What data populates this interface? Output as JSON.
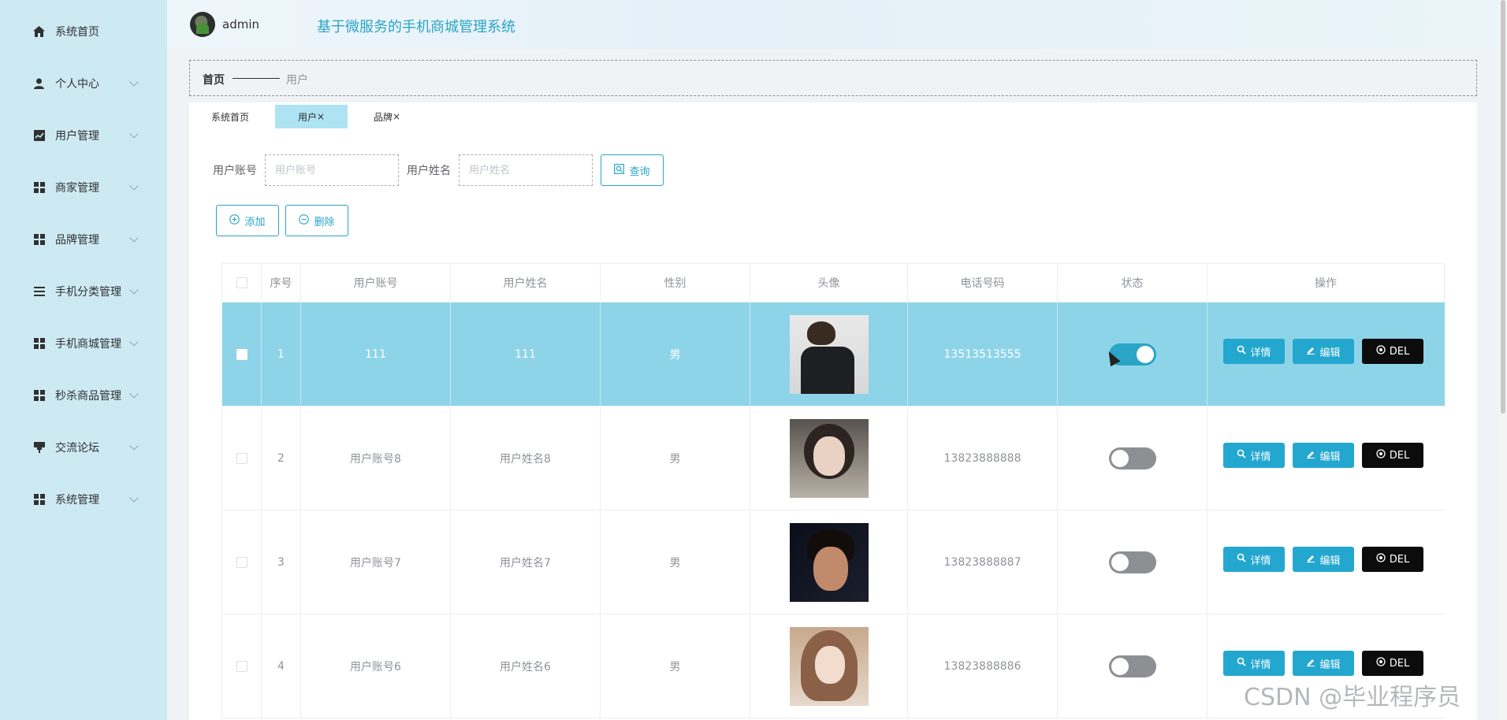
{
  "sidebar": {
    "items": [
      {
        "label": "系统首页",
        "icon": "home-icon",
        "has_children": false
      },
      {
        "label": "个人中心",
        "icon": "user-icon",
        "has_children": true
      },
      {
        "label": "用户管理",
        "icon": "chart-icon",
        "has_children": true
      },
      {
        "label": "商家管理",
        "icon": "grid-icon",
        "has_children": true
      },
      {
        "label": "品牌管理",
        "icon": "grid-icon",
        "has_children": true
      },
      {
        "label": "手机分类管理",
        "icon": "list-icon",
        "has_children": true
      },
      {
        "label": "手机商城管理",
        "icon": "grid-icon",
        "has_children": true
      },
      {
        "label": "秒杀商品管理",
        "icon": "grid-icon",
        "has_children": true
      },
      {
        "label": "交流论坛",
        "icon": "flag-icon",
        "has_children": true
      },
      {
        "label": "系统管理",
        "icon": "grid-icon",
        "has_children": true
      }
    ]
  },
  "header": {
    "username": "admin",
    "system_title": "基于微服务的手机商城管理系统"
  },
  "breadcrumb": {
    "home": "首页",
    "current": "用户"
  },
  "tabs": [
    {
      "label": "系统首页",
      "closable": false,
      "active": false
    },
    {
      "label": "用户",
      "closable": true,
      "active": true
    },
    {
      "label": "品牌",
      "closable": true,
      "active": false
    }
  ],
  "tab_close_glyph": "×",
  "search": {
    "account_label": "用户账号",
    "account_placeholder": "用户账号",
    "account_value": "",
    "name_label": "用户姓名",
    "name_placeholder": "用户姓名",
    "name_value": "",
    "query_button": "查询"
  },
  "actions": {
    "add_button": "添加",
    "delete_button": "删除"
  },
  "table": {
    "columns": [
      "",
      "序号",
      "用户账号",
      "用户姓名",
      "性别",
      "头像",
      "电话号码",
      "状态",
      "操作"
    ],
    "row_buttons": {
      "detail": "详情",
      "edit": "编辑",
      "del": "DEL"
    },
    "rows": [
      {
        "index": "1",
        "account": "111",
        "name": "111",
        "gender": "男",
        "phone": "13513513555",
        "status_on": true,
        "selected": true
      },
      {
        "index": "2",
        "account": "用户账号8",
        "name": "用户姓名8",
        "gender": "男",
        "phone": "13823888888",
        "status_on": false,
        "selected": false
      },
      {
        "index": "3",
        "account": "用户账号7",
        "name": "用户姓名7",
        "gender": "男",
        "phone": "13823888887",
        "status_on": false,
        "selected": false
      },
      {
        "index": "4",
        "account": "用户账号6",
        "name": "用户姓名6",
        "gender": "男",
        "phone": "13823888886",
        "status_on": false,
        "selected": false
      }
    ]
  },
  "watermark": "CSDN @毕业程序员",
  "colors": {
    "accent": "#2aa5c6",
    "sidebar_bg": "#cdeaf2",
    "selected_row": "#8ed4e8",
    "toggle_off": "#8d8f93",
    "del_button": "#0c0c0c"
  }
}
